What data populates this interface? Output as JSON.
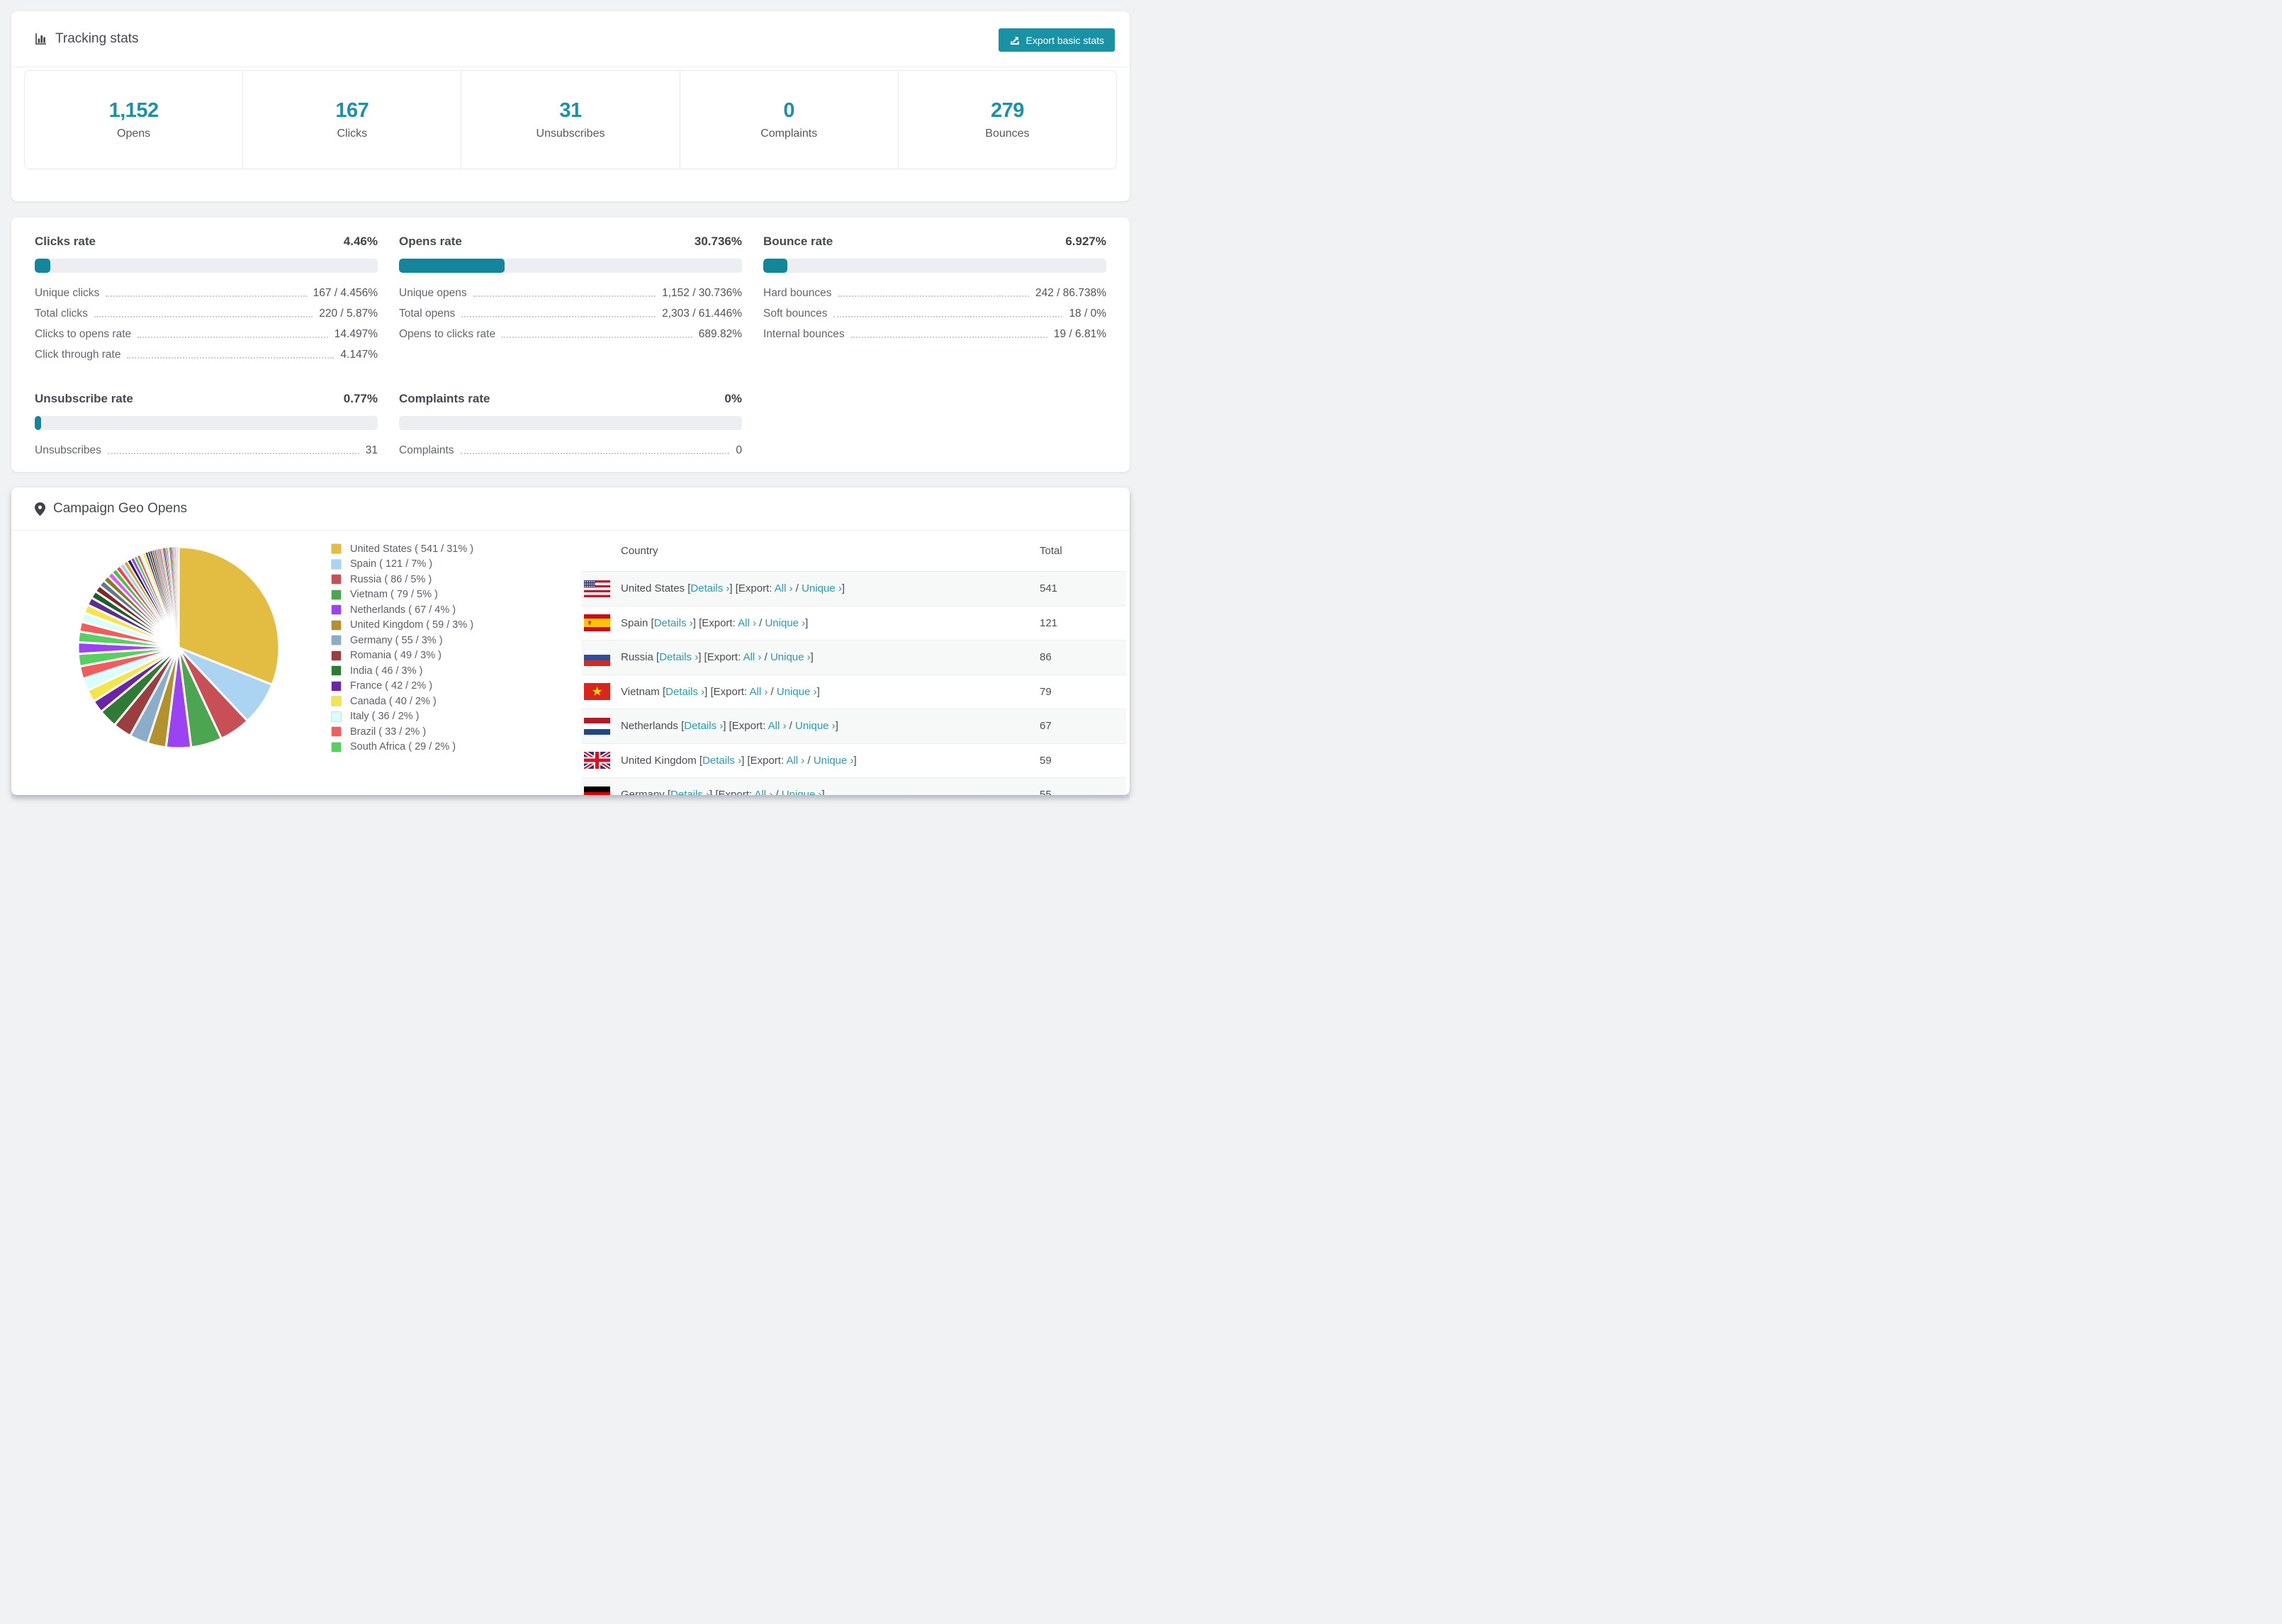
{
  "accent": "#1a91a5",
  "tracking": {
    "title": "Tracking stats",
    "export_label": "Export basic stats",
    "stats": [
      {
        "value": "1,152",
        "label": "Opens"
      },
      {
        "value": "167",
        "label": "Clicks"
      },
      {
        "value": "31",
        "label": "Unsubscribes"
      },
      {
        "value": "0",
        "label": "Complaints"
      },
      {
        "value": "279",
        "label": "Bounces"
      }
    ]
  },
  "rates": {
    "blocks": [
      {
        "title": "Clicks rate",
        "pct_label": "4.46%",
        "bar_pct": 4.46,
        "rows": [
          {
            "label": "Unique clicks",
            "value": "167 / 4.456%"
          },
          {
            "label": "Total clicks",
            "value": "220 / 5.87%"
          },
          {
            "label": "Clicks to opens rate",
            "value": "14.497%"
          },
          {
            "label": "Click through rate",
            "value": "4.147%"
          }
        ]
      },
      {
        "title": "Opens rate",
        "pct_label": "30.736%",
        "bar_pct": 30.736,
        "rows": [
          {
            "label": "Unique opens",
            "value": "1,152 / 30.736%"
          },
          {
            "label": "Total opens",
            "value": "2,303 / 61.446%"
          },
          {
            "label": "Opens to clicks rate",
            "value": "689.82%"
          }
        ]
      },
      {
        "title": "Bounce rate",
        "pct_label": "6.927%",
        "bar_pct": 6.927,
        "rows": [
          {
            "label": "Hard bounces",
            "value": "242 / 86.738%"
          },
          {
            "label": "Soft bounces",
            "value": "18 / 0%"
          },
          {
            "label": "Internal bounces",
            "value": "19 / 6.81%"
          }
        ]
      },
      {
        "title": "Unsubscribe rate",
        "pct_label": "0.77%",
        "bar_pct": 0.77,
        "rows": [
          {
            "label": "Unsubscribes",
            "value": "31"
          }
        ]
      },
      {
        "title": "Complaints rate",
        "pct_label": "0%",
        "bar_pct": 0,
        "rows": [
          {
            "label": "Complaints",
            "value": "0"
          }
        ]
      }
    ]
  },
  "geo": {
    "title": "Campaign Geo Opens",
    "table_headers": {
      "country": "Country",
      "total": "Total"
    },
    "links": {
      "details": "Details ›",
      "export_prefix": "Export:",
      "all": "All ›",
      "unique": "Unique ›"
    },
    "visible_table_rows": 7,
    "chart_data": {
      "type": "pie",
      "title": "Campaign Geo Opens",
      "legend_position": "right of pie",
      "start_angle_deg": 0,
      "direction": "clockwise",
      "series": [
        {
          "name": "United States",
          "total": 541,
          "pct": 31,
          "color": "#e3bd42",
          "flag": "us"
        },
        {
          "name": "Spain",
          "total": 121,
          "pct": 7,
          "color": "#abd3f2",
          "flag": "es"
        },
        {
          "name": "Russia",
          "total": 86,
          "pct": 5,
          "color": "#c94f57",
          "flag": "ru"
        },
        {
          "name": "Vietnam",
          "total": 79,
          "pct": 5,
          "color": "#4ba551",
          "flag": "vn"
        },
        {
          "name": "Netherlands",
          "total": 67,
          "pct": 4,
          "color": "#9b42f2",
          "flag": "nl"
        },
        {
          "name": "United Kingdom",
          "total": 59,
          "pct": 3,
          "color": "#b3922e",
          "flag": "gb"
        },
        {
          "name": "Germany",
          "total": 55,
          "pct": 3,
          "color": "#8badc9",
          "flag": "de"
        },
        {
          "name": "Romania",
          "total": 49,
          "pct": 3,
          "color": "#9c3d3f",
          "flag": "ro"
        },
        {
          "name": "India",
          "total": 46,
          "pct": 3,
          "color": "#2f7b35",
          "flag": "in"
        },
        {
          "name": "France",
          "total": 42,
          "pct": 2,
          "color": "#6a24a8",
          "flag": "fr"
        },
        {
          "name": "Canada",
          "total": 40,
          "pct": 2,
          "color": "#f6e44c",
          "flag": "ca"
        },
        {
          "name": "Italy",
          "total": 36,
          "pct": 2,
          "color": "#d8feff",
          "flag": "it"
        },
        {
          "name": "Brazil",
          "total": 33,
          "pct": 2,
          "color": "#f25c5c",
          "flag": "br"
        },
        {
          "name": "South Africa",
          "total": 29,
          "pct": 2,
          "color": "#57d061",
          "flag": "za"
        }
      ],
      "other_slices": {
        "note": "many small unlabeled country slices fanning out to 12 o'clock",
        "total_pct": 26,
        "count": 60,
        "decay": 0.93,
        "palette": [
          "#9b42f2",
          "#57d061",
          "#f25c5c",
          "#d8feff",
          "#f6e44c",
          "#5b2d8f",
          "#1f5c2e",
          "#7c2b2b",
          "#5f7a8f",
          "#8a7a20",
          "#e05cf0",
          "#49c04f",
          "#ef4444",
          "#a8d2f0",
          "#d4a72c",
          "#2a1a6e"
        ]
      }
    }
  }
}
